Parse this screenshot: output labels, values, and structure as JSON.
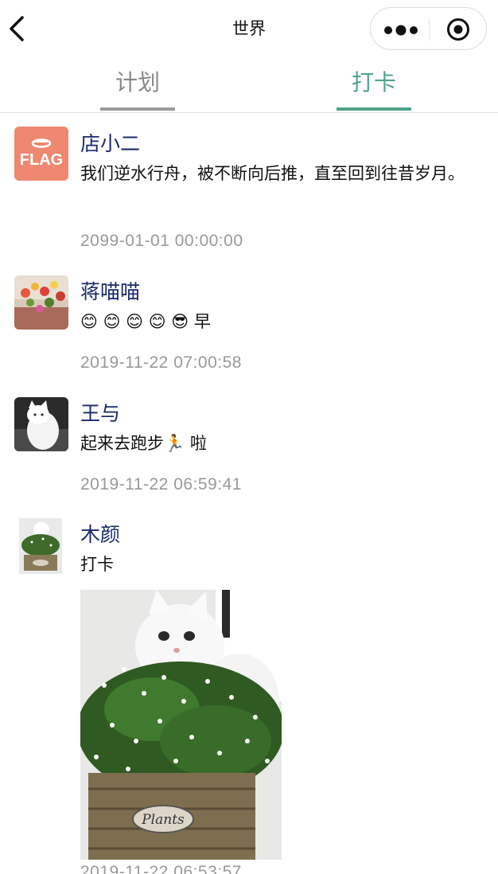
{
  "nav": {
    "title": "世界",
    "back_icon": "chevron-left-icon",
    "more_icon": "more-dots-icon",
    "close_icon": "target-circle-icon"
  },
  "tabs": [
    {
      "label": "计划",
      "active": false
    },
    {
      "label": "打卡",
      "active": true
    }
  ],
  "colors": {
    "accent": "#4fa38a",
    "name": "#1a2a6c",
    "time": "#999999",
    "flag_bg": "#ee8870"
  },
  "posts": [
    {
      "name": "店小二",
      "avatar_text": "FLAG",
      "content": "我们逆水行舟，被不断向后推，直至回到往昔岁月。",
      "time": "2099-01-01 00:00:00"
    },
    {
      "name": "蒋喵喵",
      "content": "😊 😊 😊 😊 😎 早",
      "time": "2019-11-22 07:00:58"
    },
    {
      "name": "王与",
      "content": "起来去跑步🏃 啦",
      "time": "2019-11-22 06:59:41"
    },
    {
      "name": "木颜",
      "content": "打卡",
      "photo_text": "Plants",
      "time": "2019-11-22 06:53:57"
    }
  ]
}
